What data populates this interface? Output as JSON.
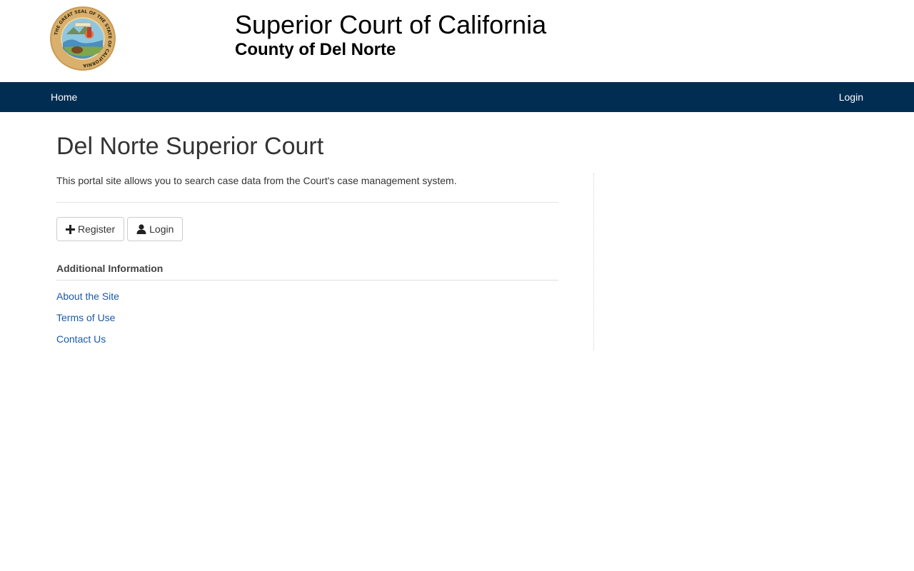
{
  "header": {
    "seal_icon": "california-great-seal",
    "seal_text": "THE GREAT SEAL OF THE STATE OF CALIFORNIA",
    "title": "Superior Court of California",
    "subtitle": "County of Del Norte"
  },
  "navbar": {
    "background": "#022d52",
    "home_label": "Home",
    "login_label": "Login"
  },
  "main": {
    "page_title": "Del Norte Superior Court",
    "intro": "This portal site allows you to search case data from the Court's case management system.",
    "buttons": {
      "register_label": "Register",
      "register_icon": "plus-icon",
      "login_label": "Login",
      "login_icon": "user-icon"
    },
    "additional_info": {
      "heading": "Additional Information",
      "links": [
        {
          "label": "About the Site"
        },
        {
          "label": "Terms of Use"
        },
        {
          "label": "Contact Us"
        }
      ]
    }
  },
  "colors": {
    "link": "#1a5aa8",
    "navbar": "#022d52"
  }
}
